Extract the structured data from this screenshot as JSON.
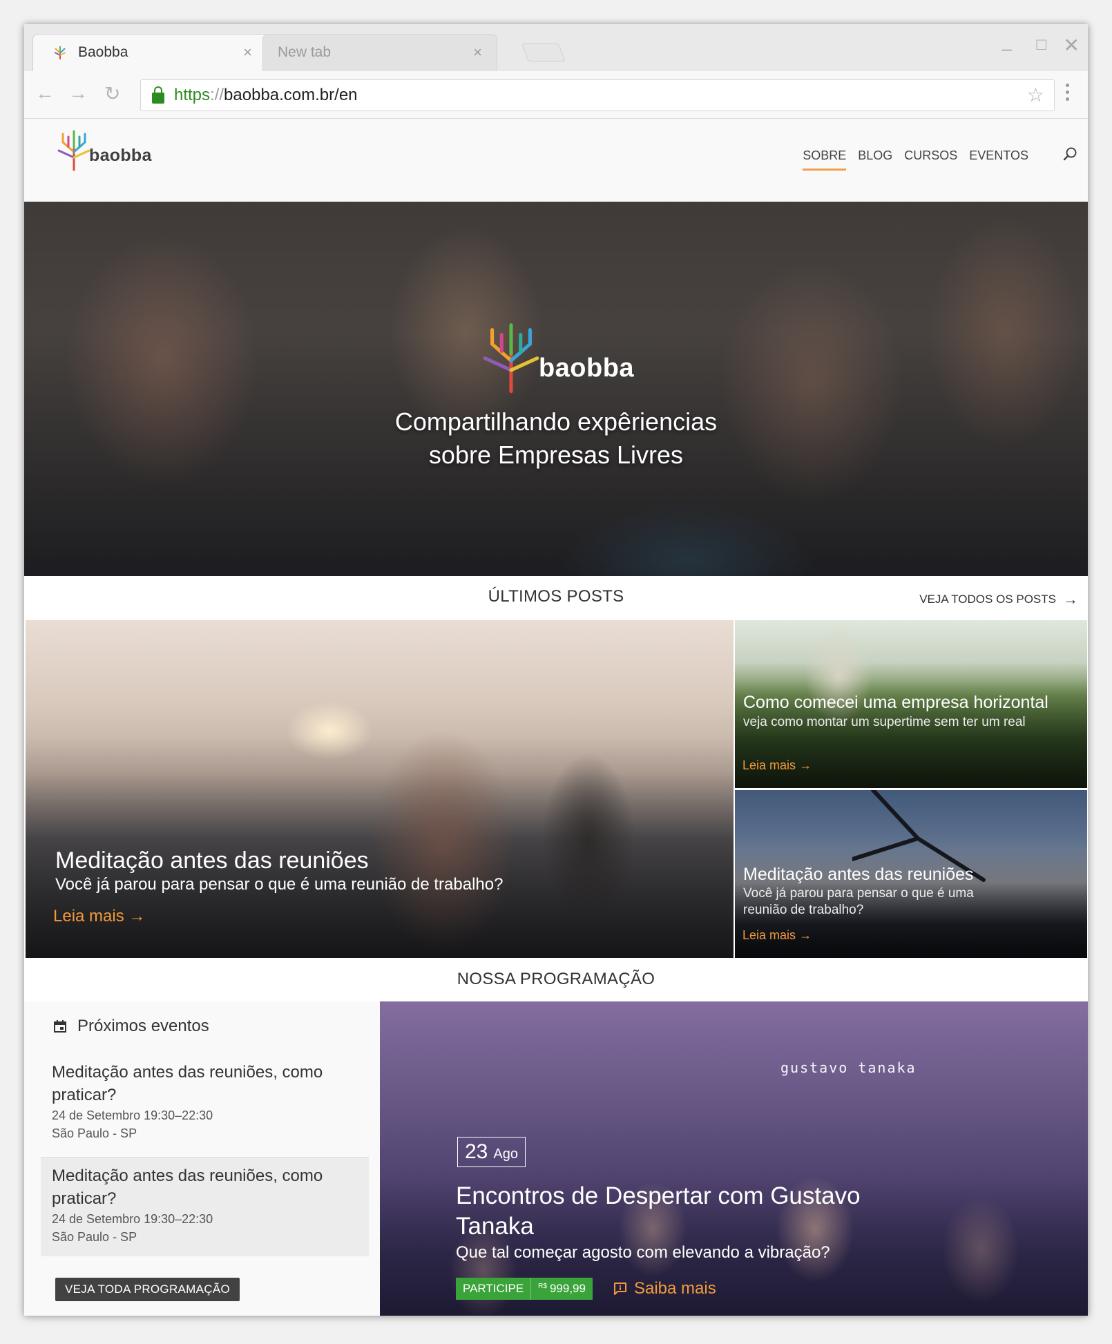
{
  "browser": {
    "tabs": [
      {
        "title": "Baobba",
        "active": true
      },
      {
        "title": "New tab",
        "active": false
      }
    ],
    "url": {
      "scheme": "https",
      "separator": "://",
      "host": "baobba.com.br/en"
    }
  },
  "site": {
    "logo_text": "baobba",
    "nav": [
      "SOBRE",
      "BLOG",
      "CURSOS",
      "EVENTOS"
    ],
    "active_nav": "SOBRE"
  },
  "hero": {
    "brand": "baobba",
    "title_line1": "Compartilhando expêriencias",
    "title_line2": "sobre Empresas Livres"
  },
  "posts": {
    "heading": "ÚLTIMOS POSTS",
    "see_all": "VEJA TODOS OS POSTS",
    "main": {
      "title": "Meditação antes das reuniões",
      "subtitle": "Você já parou para pensar o que é uma reunião de trabalho?",
      "more": "Leia mais"
    },
    "side": [
      {
        "title": "Como comecei uma empresa horizontal",
        "subtitle": "veja como montar um supertime sem ter um real",
        "more": "Leia mais"
      },
      {
        "title": "Meditação antes das reuniões",
        "subtitle": "Você já parou para pensar o que é uma reunião de trabalho?",
        "more": "Leia mais"
      }
    ]
  },
  "program": {
    "heading": "NOSSA PROGRAMAÇÃO",
    "upcoming_label": "Próximos eventos",
    "events": [
      {
        "title": "Meditação antes das reuniões, como praticar?",
        "datetime": "24 de Setembro 19:30–22:30",
        "location": "São Paulo - SP"
      },
      {
        "title": "Meditação antes das reuniões, como praticar?",
        "datetime": "24 de Setembro 19:30–22:30",
        "location": "São Paulo - SP"
      }
    ],
    "see_all_button": "VEJA TODA PROGRAMAÇÃO",
    "featured": {
      "signature": "gustavo tanaka",
      "day": "23",
      "month": "Ago",
      "title": "Encontros de Despertar com Gustavo Tanaka",
      "subtitle": "Que tal começar agosto com elevando a vibração?",
      "cta_label": "PARTICIPE",
      "currency": "R$",
      "price": "999,99",
      "more": "Saiba mais"
    }
  },
  "colors": {
    "accent": "#f39a3c",
    "cta_green": "#3aa43a",
    "secure_green": "#2e8b22"
  }
}
